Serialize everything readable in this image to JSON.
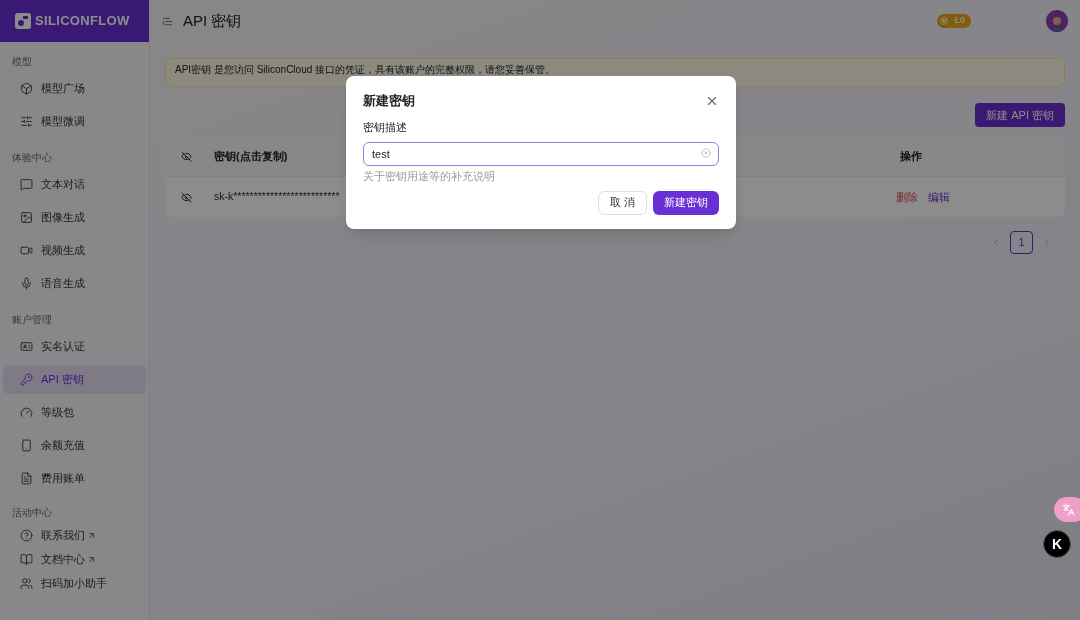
{
  "sidebar": {
    "logo": "SILICONFLOW",
    "sections": [
      {
        "title": "模型",
        "items": [
          {
            "label": "模型广场",
            "selected": false,
            "external": false
          },
          {
            "label": "模型微调",
            "selected": false,
            "external": false
          }
        ]
      },
      {
        "title": "体验中心",
        "items": [
          {
            "label": "文本对话",
            "selected": false,
            "external": false
          },
          {
            "label": "图像生成",
            "selected": false,
            "external": false
          },
          {
            "label": "视频生成",
            "selected": false,
            "external": false
          },
          {
            "label": "语音生成",
            "selected": false,
            "external": false
          }
        ]
      },
      {
        "title": "账户管理",
        "items": [
          {
            "label": "实名认证",
            "selected": false,
            "external": false
          },
          {
            "label": "API 密钥",
            "selected": true,
            "external": false
          },
          {
            "label": "等级包",
            "selected": false,
            "external": false
          },
          {
            "label": "余额充值",
            "selected": false,
            "external": false
          },
          {
            "label": "费用账单",
            "selected": false,
            "external": false
          }
        ]
      },
      {
        "title": "活动中心",
        "items": [
          {
            "label": "联系我们",
            "selected": false,
            "external": true
          },
          {
            "label": "文档中心",
            "selected": false,
            "external": true
          },
          {
            "label": "扫码加小助手",
            "selected": false,
            "external": false
          }
        ]
      }
    ]
  },
  "header": {
    "title": "API 密钥",
    "level_badge": "L0",
    "badge_letter": "V"
  },
  "alert": "API密钥 是您访问 SiliconCloud 接口的凭证，具有该账户的完整权限，请您妥善保管。",
  "create_button": "新建 API 密钥",
  "table": {
    "columns": [
      "密钥(点击复制)",
      "操作"
    ],
    "rows": [
      {
        "key": "sk-k**************************",
        "actions": [
          {
            "label": "删除",
            "kind": "danger"
          },
          {
            "label": "编辑",
            "kind": "link"
          }
        ]
      }
    ]
  },
  "pagination": {
    "pages": [
      {
        "label": "1",
        "selected": true
      }
    ]
  },
  "dialog": {
    "title": "新建密钥",
    "field_label": "密钥描述",
    "value": "test",
    "help": "关于密钥用途等的补充说明",
    "buttons": [
      {
        "label": "取 消",
        "kind": "secondary"
      },
      {
        "label": "新建密钥",
        "kind": "primary"
      }
    ]
  },
  "floating": {
    "assistant": "K"
  }
}
